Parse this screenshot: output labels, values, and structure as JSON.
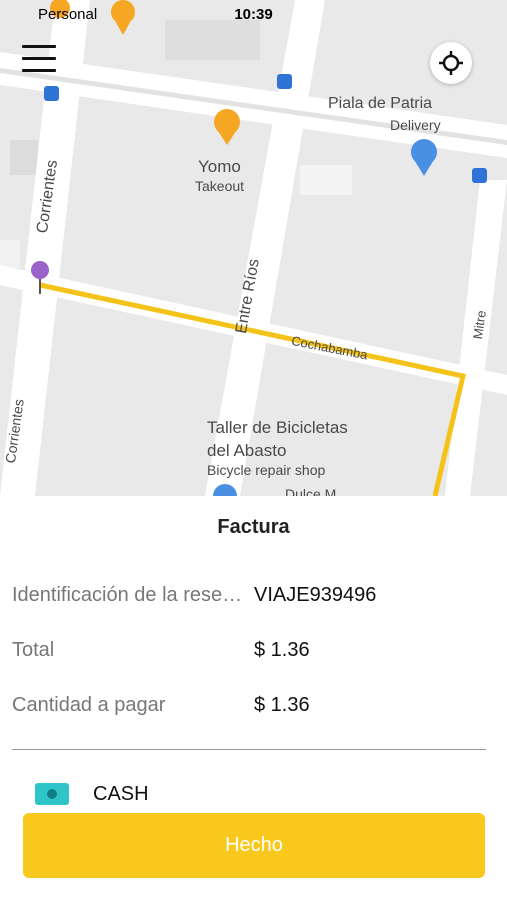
{
  "status_bar": {
    "carrier": "Personal",
    "time": "10:39"
  },
  "map": {
    "streets": {
      "corrientes": "Corrientes",
      "corrientes_lower": "Corrientes",
      "entre_rios": "Entre Ríos",
      "cochabamba": "Cochabamba",
      "mitre": "Mitre"
    },
    "places": {
      "piala_name": "Piala de Patria",
      "piala_type": "Delivery",
      "yomo_name": "Yomo",
      "yomo_type": "Takeout",
      "taller_line1": "Taller de Bicicletas",
      "taller_line2": "del Abasto",
      "taller_type": "Bicycle repair shop",
      "partial": "Dulce M"
    },
    "route_color": "#f4c31a"
  },
  "sheet": {
    "title": "Factura",
    "rows": [
      {
        "label": "Identificación de la reserva",
        "value": "VIAJE939496"
      },
      {
        "label": "Total",
        "value": "$ 1.36"
      },
      {
        "label": "Cantidad a pagar",
        "value": "$ 1.36"
      }
    ],
    "payment": {
      "icon": "cash-icon",
      "label": "CASH"
    },
    "done_button": "Hecho",
    "accent_color": "#f9c81c"
  }
}
